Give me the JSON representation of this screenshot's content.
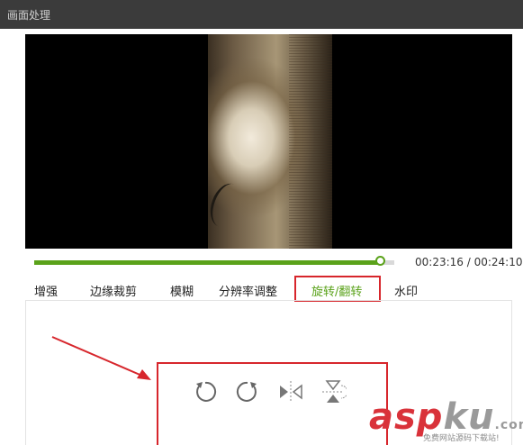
{
  "window": {
    "title": "画面处理"
  },
  "player": {
    "current_time": "00:23:16",
    "total_time": "00:24:10",
    "time_separator": " / ",
    "progress": 0.9625,
    "accent_color": "#5aa21a"
  },
  "tabs": [
    {
      "label": "增强"
    },
    {
      "label": "边缘裁剪"
    },
    {
      "label": "模糊"
    },
    {
      "label": "分辨率调整"
    },
    {
      "label": "旋转/翻转",
      "active": true
    },
    {
      "label": "水印"
    }
  ],
  "rotate_controls": [
    {
      "icon": "rotate-left-icon"
    },
    {
      "icon": "rotate-right-icon"
    },
    {
      "icon": "flip-horizontal-icon"
    },
    {
      "icon": "flip-vertical-icon"
    }
  ],
  "annotation": {
    "highlight_color": "#d7262c"
  },
  "watermark": {
    "brand_a": "asp",
    "brand_b": "ku",
    "suffix": ".com",
    "subtitle": "免费网站源码下载站!"
  }
}
